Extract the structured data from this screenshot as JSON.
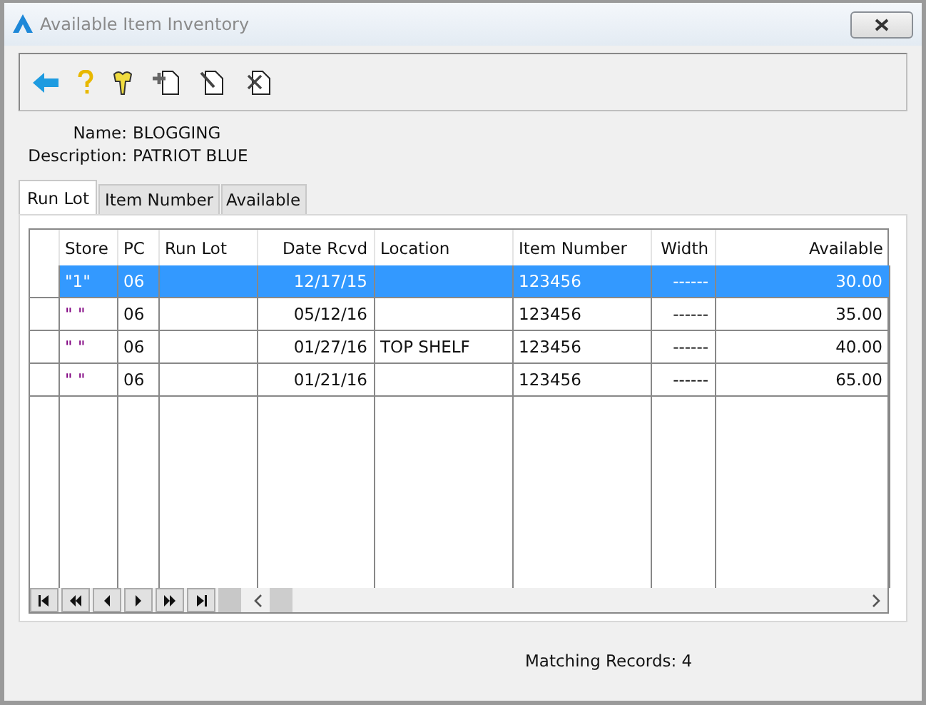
{
  "window": {
    "title": "Available Item Inventory"
  },
  "info": [
    {
      "label": "Name:",
      "value": "BLOGGING"
    },
    {
      "label": "Description:",
      "value": "PATRIOT BLUE"
    }
  ],
  "tabs": [
    {
      "label": "Run Lot",
      "selected": true
    },
    {
      "label": "Item Number",
      "selected": false
    },
    {
      "label": "Available",
      "selected": false
    }
  ],
  "table": {
    "columns": [
      "Store",
      "PC",
      "Run Lot",
      "Date Rcvd",
      "Location",
      "Item Number",
      "Width",
      "Available"
    ],
    "rows": [
      {
        "selected": true,
        "cells": [
          "\"1\"",
          "06",
          "",
          "12/17/15",
          "",
          "123456",
          "------",
          "30.00"
        ]
      },
      {
        "selected": false,
        "cells": [
          "\" \"",
          "06",
          "",
          "05/12/16",
          "",
          "123456",
          "------",
          "35.00"
        ]
      },
      {
        "selected": false,
        "cells": [
          "\" \"",
          "06",
          "",
          "01/27/16",
          "TOP SHELF",
          "123456",
          "------",
          "40.00"
        ]
      },
      {
        "selected": false,
        "cells": [
          "\" \"",
          "06",
          "",
          "01/21/16",
          "",
          "123456",
          "------",
          "65.00"
        ]
      }
    ]
  },
  "status_bar": "Matching Records: 4"
}
